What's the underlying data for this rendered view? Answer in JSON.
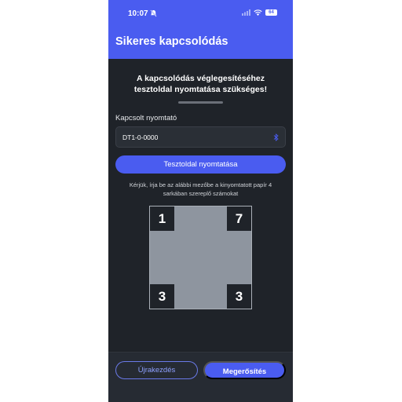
{
  "status_bar": {
    "time": "10:07",
    "battery": "64"
  },
  "header": {
    "title": "Sikeres kapcsolódás"
  },
  "main": {
    "headline_line1": "A kapcsolódás véglegesítéséhez",
    "headline_line2": "tesztoldal nyomtatása szükséges!",
    "printer_label": "Kapcsolt nyomtató",
    "printer_value": "DT1-0-0000",
    "print_button_label": "Tesztoldal nyomtatása",
    "instructions_line1": "Kérjük, írja be az alábbi mezőbe a kinyomtatott papír 4",
    "instructions_line2": "sarkában szereplő számokat",
    "corners": {
      "top_left": "1",
      "top_right": "7",
      "bottom_left": "3",
      "bottom_right": "3"
    }
  },
  "footer": {
    "restart_label": "Újrakezdés",
    "confirm_label": "Megerősítés"
  },
  "colors": {
    "accent": "#4a5cf0",
    "background": "#1f2329"
  }
}
